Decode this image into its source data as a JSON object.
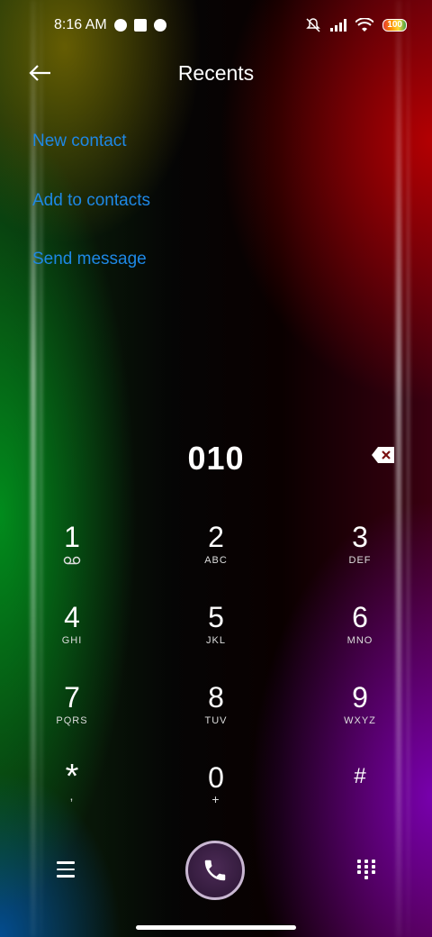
{
  "status": {
    "time": "8:16 AM",
    "battery": "100"
  },
  "header": {
    "title": "Recents"
  },
  "actions": [
    "New contact",
    "Add to contacts",
    "Send message"
  ],
  "display": {
    "number": "010"
  },
  "keys": [
    {
      "digit": "1",
      "letters": ""
    },
    {
      "digit": "2",
      "letters": "ABC"
    },
    {
      "digit": "3",
      "letters": "DEF"
    },
    {
      "digit": "4",
      "letters": "GHI"
    },
    {
      "digit": "5",
      "letters": "JKL"
    },
    {
      "digit": "6",
      "letters": "MNO"
    },
    {
      "digit": "7",
      "letters": "PQRS"
    },
    {
      "digit": "8",
      "letters": "TUV"
    },
    {
      "digit": "9",
      "letters": "WXYZ"
    },
    {
      "digit": "*",
      "letters": ","
    },
    {
      "digit": "0",
      "letters": "+"
    },
    {
      "digit": "#",
      "letters": ""
    }
  ],
  "colors": {
    "accent": "#1e88e5",
    "call_button": "#3a1f44"
  },
  "icons": [
    "back-arrow-icon",
    "backspace-icon",
    "voicemail-icon",
    "menu-icon",
    "phone-icon",
    "dialpad-icon"
  ]
}
